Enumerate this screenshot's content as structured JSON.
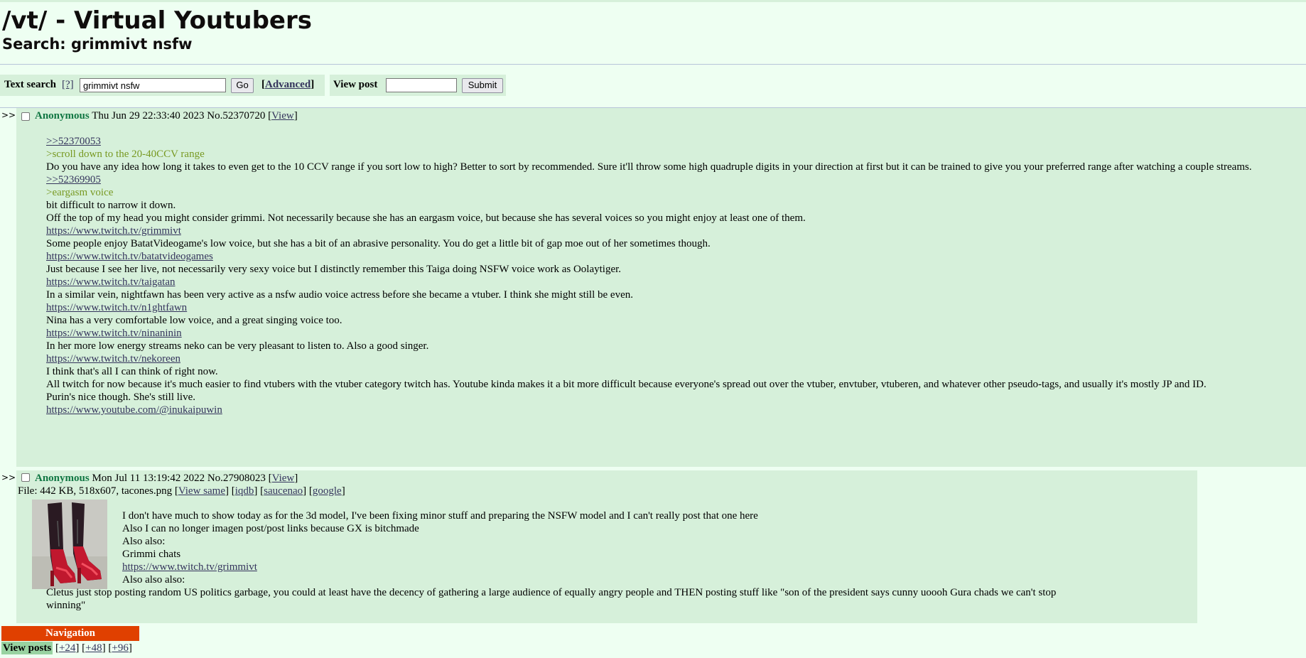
{
  "header": {
    "board_title": "/vt/ - Virtual Youtubers",
    "search_title": "Search: grimmivt nsfw"
  },
  "searchbar": {
    "text_search_label": "Text search",
    "help_link": "[?]",
    "search_value": "grimmivt nsfw",
    "go_label": "Go",
    "advanced_label": "Advanced",
    "view_post_label": "View post",
    "view_post_value": "",
    "submit_label": "Submit"
  },
  "posts": [
    {
      "arrows": ">>",
      "name": "Anonymous",
      "datetime": "Thu Jun 29 22:33:40 2023",
      "number": "No.52370720",
      "view_label": "View",
      "lines": [
        {
          "type": "link",
          "text": ">>52370053"
        },
        {
          "type": "quote",
          "text": ">scroll down to the 20-40CCV range"
        },
        {
          "type": "text",
          "text": "Do you have any idea how long it takes to even get to the 10 CCV range if you sort low to high? Better to sort by recommended. Sure it'll throw some high quadruple digits in your direction at first but it can be trained to give you your preferred range after watching a couple streams."
        },
        {
          "type": "link",
          "text": ">>52369905"
        },
        {
          "type": "quote",
          "text": ">eargasm voice"
        },
        {
          "type": "text",
          "text": "bit difficult to narrow it down."
        },
        {
          "type": "text",
          "text": "Off the top of my head you might consider grimmi. Not necessarily because she has an eargasm voice, but because she has several voices so you might enjoy at least one of them."
        },
        {
          "type": "link",
          "text": "https://www.twitch.tv/grimmivt"
        },
        {
          "type": "text",
          "text": "Some people enjoy BatatVideogame's low voice, but she has a bit of an abrasive personality. You do get a little bit of gap moe out of her sometimes though."
        },
        {
          "type": "link",
          "text": "https://www.twitch.tv/batatvideogames"
        },
        {
          "type": "text",
          "text": "Just because I see her live, not necessarily very sexy voice but I distinctly remember this Taiga doing NSFW voice work as Oolaytiger."
        },
        {
          "type": "link",
          "text": "https://www.twitch.tv/taigatan"
        },
        {
          "type": "text",
          "text": "In a similar vein, nightfawn has been very active as a nsfw audio voice actress before she became a vtuber. I think she might still be even."
        },
        {
          "type": "link",
          "text": "https://www.twitch.tv/n1ghtfawn"
        },
        {
          "type": "text",
          "text": "Nina has a very comfortable low voice, and a great singing voice too."
        },
        {
          "type": "link",
          "text": "https://www.twitch.tv/ninaninin"
        },
        {
          "type": "text",
          "text": "In her more low energy streams neko can be very pleasant to listen to. Also a good singer."
        },
        {
          "type": "link",
          "text": "https://www.twitch.tv/nekoreen"
        },
        {
          "type": "text",
          "text": " "
        },
        {
          "type": "text",
          "text": "I think that's all I can think of right now."
        },
        {
          "type": "text",
          "text": "All twitch for now because it's much easier to find vtubers with the vtuber category twitch has. Youtube kinda makes it a bit more difficult because everyone's spread out over the vtuber, envtuber, vtuberen, and whatever other pseudo-tags, and usually it's mostly JP and ID."
        },
        {
          "type": "text",
          "text": "Purin's nice though. She's still live."
        },
        {
          "type": "link",
          "text": "https://www.youtube.com/@inukaipuwin"
        }
      ]
    },
    {
      "arrows": ">>",
      "name": "Anonymous",
      "datetime": "Mon Jul 11 13:19:42 2022",
      "number": "No.27908023",
      "view_label": "View",
      "file_prefix": "File: 442 KB, 518x607, tacones.png",
      "file_links": [
        "View same",
        "iqdb",
        "saucenao",
        "google"
      ],
      "lines": [
        {
          "type": "text",
          "text": "I don't have much to show today as for the 3d model, I've been fixing minor stuff and preparing the NSFW model and I can't really post that one here"
        },
        {
          "type": "text",
          "text": "Also I can no longer imagen post/post links because GX is bitchmade"
        },
        {
          "type": "text",
          "text": "Also also:"
        },
        {
          "type": "text",
          "text": "Grimmi chats"
        },
        {
          "type": "link",
          "text": "https://www.twitch.tv/grimmivt"
        },
        {
          "type": "text",
          "text": "Also also also:"
        },
        {
          "type": "text",
          "text": "Cletus just stop posting random US politics garbage, you could at least have the decency of gathering a large audience of equally angry people and THEN posting stuff like \"son of the president says cunny uoooh Gura chads we can't stop winning\""
        }
      ]
    }
  ],
  "navigation": {
    "title": "Navigation",
    "view_posts_label": "View posts",
    "links": [
      "+24",
      "+48",
      "+96"
    ]
  }
}
